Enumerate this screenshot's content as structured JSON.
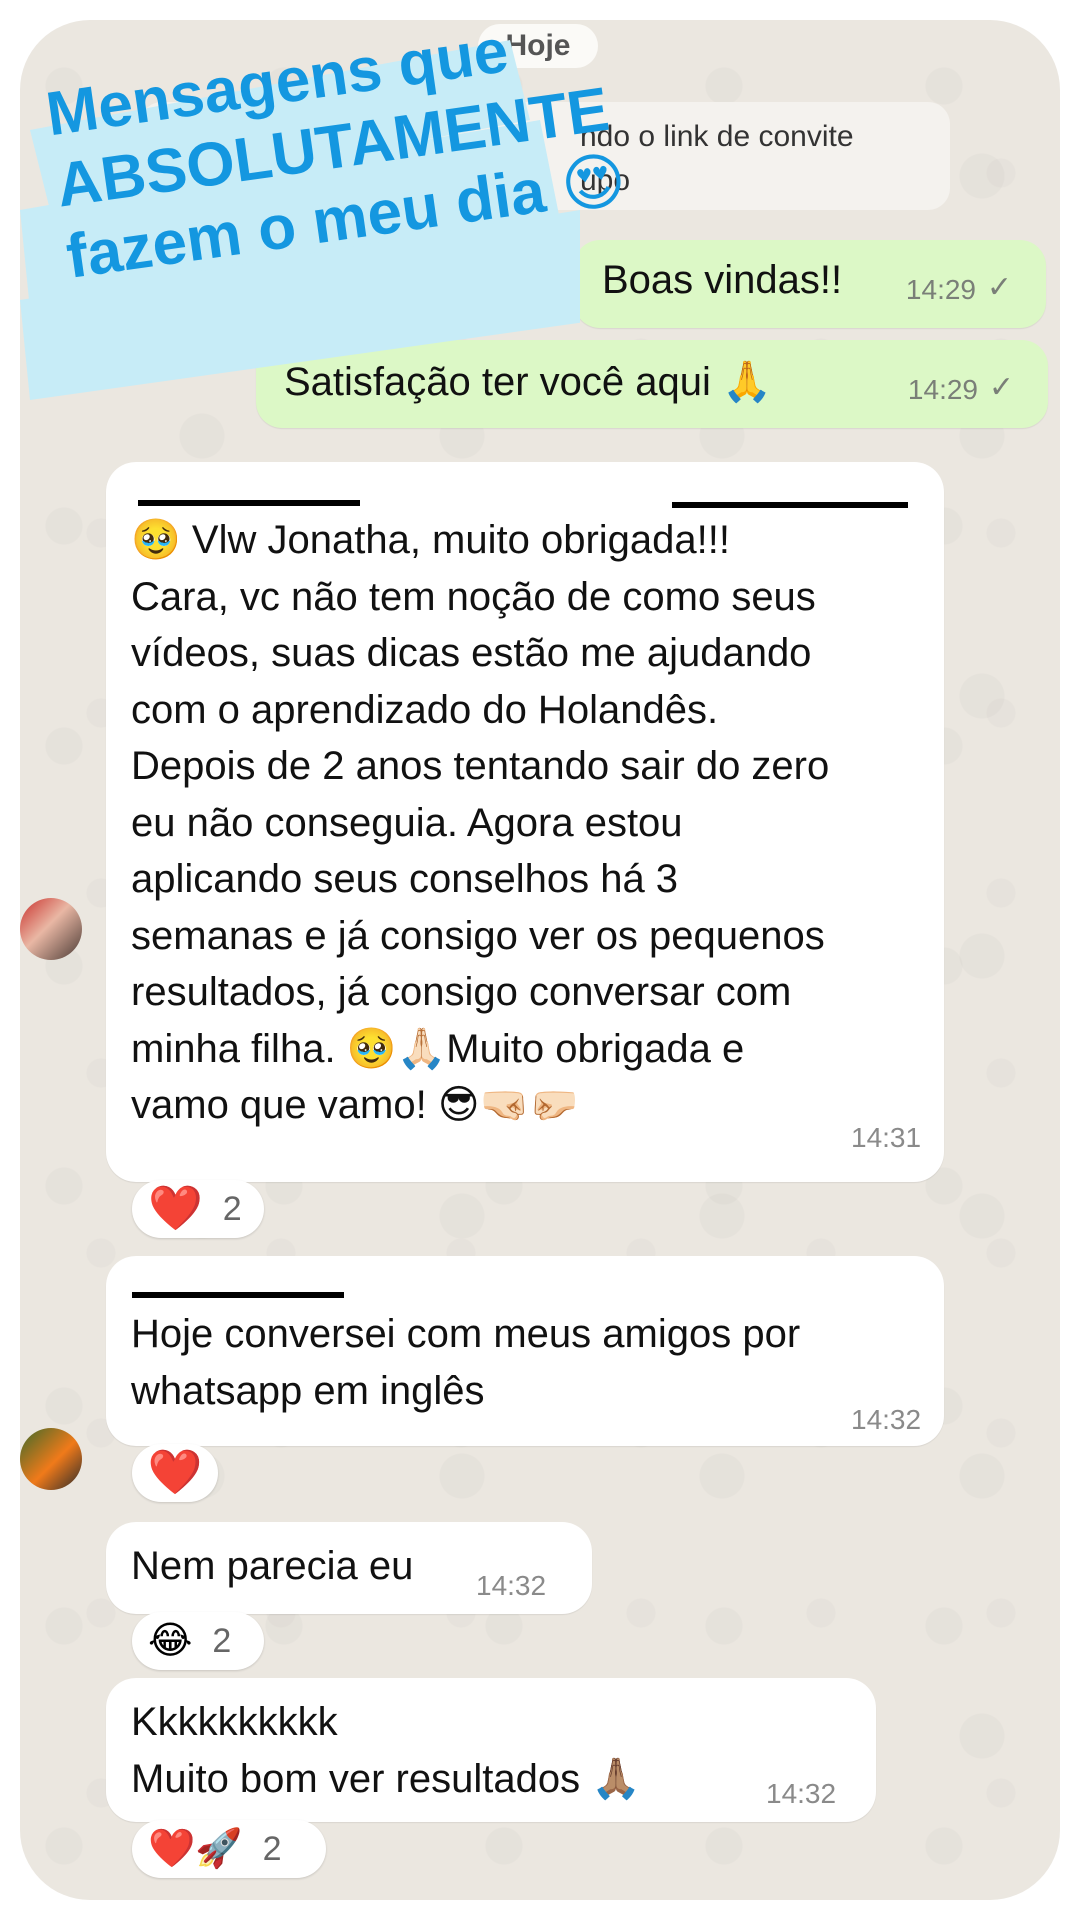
{
  "date_chip": "Hoje",
  "system_message": {
    "line1": "ndo o link de convite",
    "line2": "upo"
  },
  "overlay": {
    "line1": "Mensagens que",
    "line2": "ABSOLUTAMENTE",
    "line3": "fazem o meu dia 😍",
    "color": "#1497e0",
    "highlight": "#c7ecf7"
  },
  "outgoing": [
    {
      "text": "Boas vindas!!",
      "time": "14:29",
      "status": "✓"
    },
    {
      "text": "Satisfação ter você aqui 🙏",
      "time": "14:29",
      "status": "✓"
    }
  ],
  "incoming": [
    {
      "lines": [
        "🥹 Vlw Jonatha, muito obrigada!!!",
        "Cara, vc não tem noção de como seus",
        "vídeos, suas dicas estão me ajudando",
        "com o aprendizado do Holandês.",
        "Depois de 2 anos tentando sair do zero",
        "eu não conseguia. Agora estou",
        "aplicando seus conselhos há 3",
        "semanas e já consigo ver os pequenos",
        "resultados, já consigo conversar com",
        "minha filha. 🥹🙏🏻Muito obrigada e",
        "vamo que vamo! 😎🤜🏻🤛🏻"
      ],
      "time": "14:31",
      "reaction": {
        "emojis": "❤️",
        "count": "2"
      }
    },
    {
      "lines": [
        "Hoje conversei com meus amigos por",
        "whatsapp em inglês"
      ],
      "time": "14:32",
      "reaction": {
        "emojis": "❤️",
        "count": ""
      }
    },
    {
      "lines": [
        "Nem parecia eu"
      ],
      "time": "14:32",
      "reaction": {
        "emojis": "😂",
        "count": "2"
      }
    },
    {
      "lines": [
        "Kkkkkkkkkk",
        "Muito bom ver resultados 🙏🏽"
      ],
      "time": "14:32",
      "reaction": {
        "emojis": "❤️🚀",
        "count": "2"
      }
    }
  ]
}
